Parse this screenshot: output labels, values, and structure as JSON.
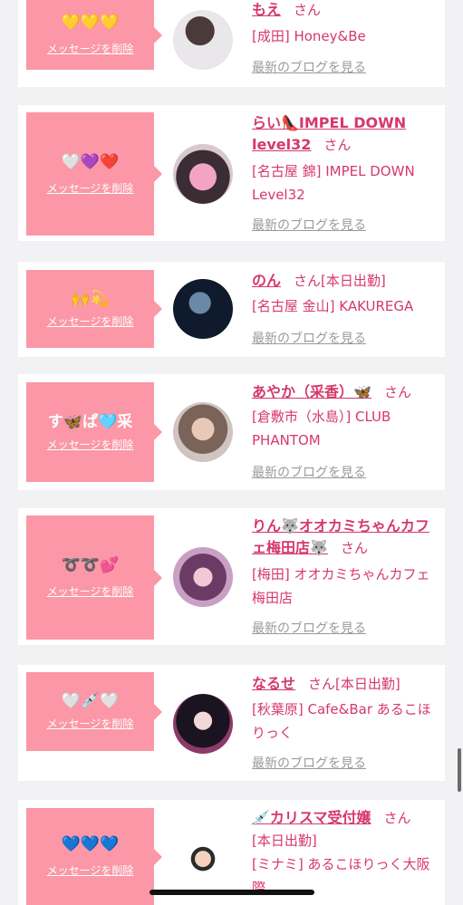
{
  "common": {
    "delete_label": "メッセージを削除",
    "san_label": "さん",
    "blog_label": "最新のブログを見る"
  },
  "cards": [
    {
      "emoji": "💛💛💛",
      "name": "もえ",
      "shop": "[成田] Honey&Be"
    },
    {
      "emoji": "🤍💜❤️",
      "name": "らい👠IMPEL DOWN level32",
      "shop": "[名古屋 錦] IMPEL DOWN Level32"
    },
    {
      "emoji": "🙌💫",
      "name": "のん",
      "status": "[本日出勤]",
      "shop": "[名古屋 金山] KAKUREGA"
    },
    {
      "emoji": "す🦋ぱ🩵采",
      "name": "あやか（采香）🦋",
      "shop": "[倉敷市（水島）] CLUB PHANTOM"
    },
    {
      "emoji": "➰➰💕",
      "name": "りん🐺オオカミちゃんカフェ梅田店🐺",
      "shop": "[梅田] オオカミちゃんカフェ梅田店"
    },
    {
      "emoji": "🤍💉🤍",
      "name": "なるせ",
      "status": "[本日出勤]",
      "shop": "[秋葉原] Cafe&Bar あるこほりっく"
    },
    {
      "emoji": "💙💙💙",
      "name": "💉カリスマ受付嬢",
      "status_line": "[本日出勤]",
      "shop": "[ミナミ] あるこほりっく大阪際"
    }
  ],
  "colors": {
    "accent": "#d6386a",
    "message_box": "#fb97a6",
    "background": "#f2f2f4"
  }
}
